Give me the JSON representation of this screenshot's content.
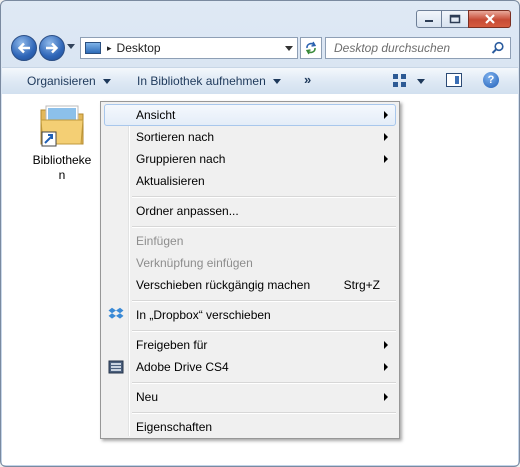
{
  "window": {
    "caption": {
      "minimize_label": "Minimieren",
      "maximize_label": "Maximieren",
      "close_label": "Schließen"
    }
  },
  "navbar": {
    "address": {
      "location": "Desktop",
      "separator": "▸"
    },
    "search": {
      "placeholder": "Desktop durchsuchen"
    }
  },
  "toolbar": {
    "organize": "Organisieren",
    "include_library": "In Bibliothek aufnehmen",
    "more": "»",
    "help": "?"
  },
  "desktop": {
    "items": [
      {
        "label": "Bibliotheken",
        "icon": "libraries-folder-icon"
      }
    ]
  },
  "context_menu": {
    "items": [
      {
        "label": "Ansicht",
        "submenu": true,
        "hover": true
      },
      {
        "label": "Sortieren nach",
        "submenu": true
      },
      {
        "label": "Gruppieren nach",
        "submenu": true
      },
      {
        "label": "Aktualisieren"
      },
      {
        "label": "Ordner anpassen..."
      },
      {
        "label": "Einfügen",
        "disabled": true
      },
      {
        "label": "Verknüpfung einfügen",
        "disabled": true
      },
      {
        "label": "Verschieben rückgängig machen",
        "shortcut": "Strg+Z"
      },
      {
        "label": "In „Dropbox“ verschieben",
        "icon": "dropbox-icon"
      },
      {
        "label": "Freigeben für",
        "submenu": true
      },
      {
        "label": "Adobe Drive CS4",
        "submenu": true,
        "icon": "adobe-drive-icon"
      },
      {
        "label": "Neu",
        "submenu": true
      },
      {
        "label": "Eigenschaften"
      }
    ]
  },
  "colors": {
    "accent": "#2f66b8",
    "menu_background": "#f0f0f0",
    "hover_border": "#a8c7ec",
    "disabled_text": "#8d8d8d",
    "close_button": "#c74b35"
  }
}
